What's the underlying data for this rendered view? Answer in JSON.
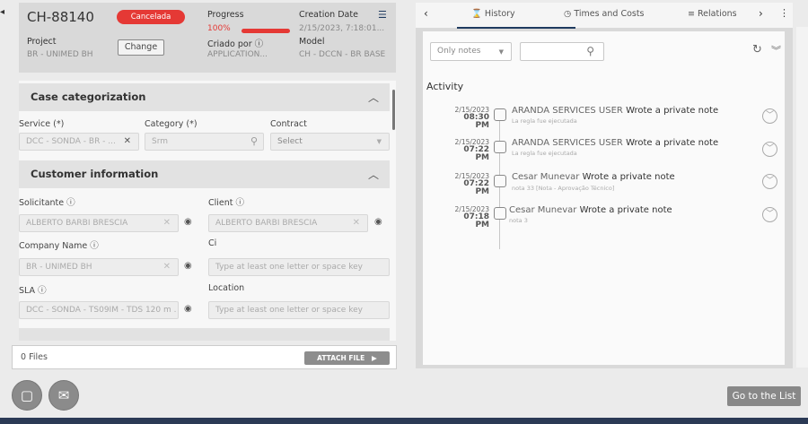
{
  "header": {
    "case_id": "CH-88140",
    "status": "Cancelada",
    "progress_label": "Progress",
    "progress_value": "100%",
    "progress_fraction": 1.0,
    "creation_date_label": "Creation Date",
    "creation_date_value": "2/15/2023, 7:18:01...",
    "project_label": "Project",
    "project_value": "BR - UNIMED BH",
    "change_label": "Change",
    "created_by_label": "Criado por",
    "created_by_value": "APPLICATION...",
    "model_label": "Model",
    "model_value": "CH - DCCN - BR BASE"
  },
  "case_categorization": {
    "title": "Case categorization",
    "service_label": "Service (*)",
    "service_value": "DCC - SONDA - BR - ...",
    "category_label": "Category (*)",
    "category_value": "Srm",
    "contract_label": "Contract",
    "contract_value": "Select"
  },
  "customer_information": {
    "title": "Customer information",
    "solicitante_label": "Solicitante",
    "solicitante_value": "ALBERTO BARBI BRESCIA",
    "client_label": "Client",
    "client_value": "ALBERTO BARBI BRESCIA",
    "company_label": "Company Name",
    "company_value": "BR - UNIMED BH",
    "ci_label": "Ci",
    "ci_placeholder": "Type at least one letter or space key",
    "sla_label": "SLA",
    "sla_value": "DCC - SONDA - TS09IM - TDS 120 m ...",
    "location_label": "Location",
    "location_placeholder": "Type at least one letter or space key"
  },
  "files": {
    "count_label": "0 Files",
    "attach_label": "ATTACH FILE"
  },
  "tabs": {
    "history": "History",
    "times_costs": "Times and Costs",
    "relations": "Relations"
  },
  "activity": {
    "filter_value": "Only notes",
    "title": "Activity",
    "items": [
      {
        "date": "2/15/2023",
        "time": "08:30 PM",
        "user": "ARANDA SERVICES USER",
        "action": "Wrote a private note",
        "sub": "La regla fue ejecutada"
      },
      {
        "date": "2/15/2023",
        "time": "07:22 PM",
        "user": "ARANDA SERVICES USER",
        "action": "Wrote a private note",
        "sub": "La regla fue ejecutada"
      },
      {
        "date": "2/15/2023",
        "time": "07:22 PM",
        "user": "Cesar Munevar",
        "action": "Wrote a private note",
        "sub": "nota 33 [Nota - Aprovação Técnico]"
      },
      {
        "date": "2/15/2023",
        "time": "07:18 PM",
        "user": "Cesar Munevar",
        "action": "Wrote a private note",
        "sub": "nota 3"
      }
    ]
  },
  "footer": {
    "go_to_list": "Go to the List"
  },
  "colors": {
    "status_red": "#e53935",
    "tab_active": "#1e3a5f"
  }
}
